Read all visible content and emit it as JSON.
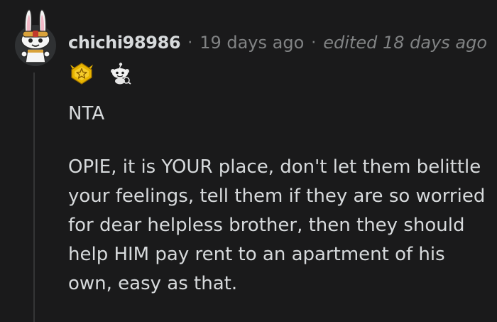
{
  "comment": {
    "username": "chichi98986",
    "separator": "·",
    "posted": "19 days ago",
    "edited": "edited 18 days ago",
    "avatar_icon": "bunny-snoo-avatar-icon",
    "awards": [
      {
        "icon": "gold-star-award-icon"
      },
      {
        "icon": "snoo-award-icon"
      }
    ],
    "body": [
      "NTA",
      "OPIE, it is YOUR place, don't let them belittle your feelings, tell them if they are so worried for dear helpless brother, then they should help HIM pay rent to an apartment of his own, easy as that."
    ]
  },
  "colors": {
    "background": "#1a1a1b",
    "text": "#d7dadc",
    "meta": "#818384",
    "thread_line": "#343536",
    "award_gold": "#e7b400"
  }
}
